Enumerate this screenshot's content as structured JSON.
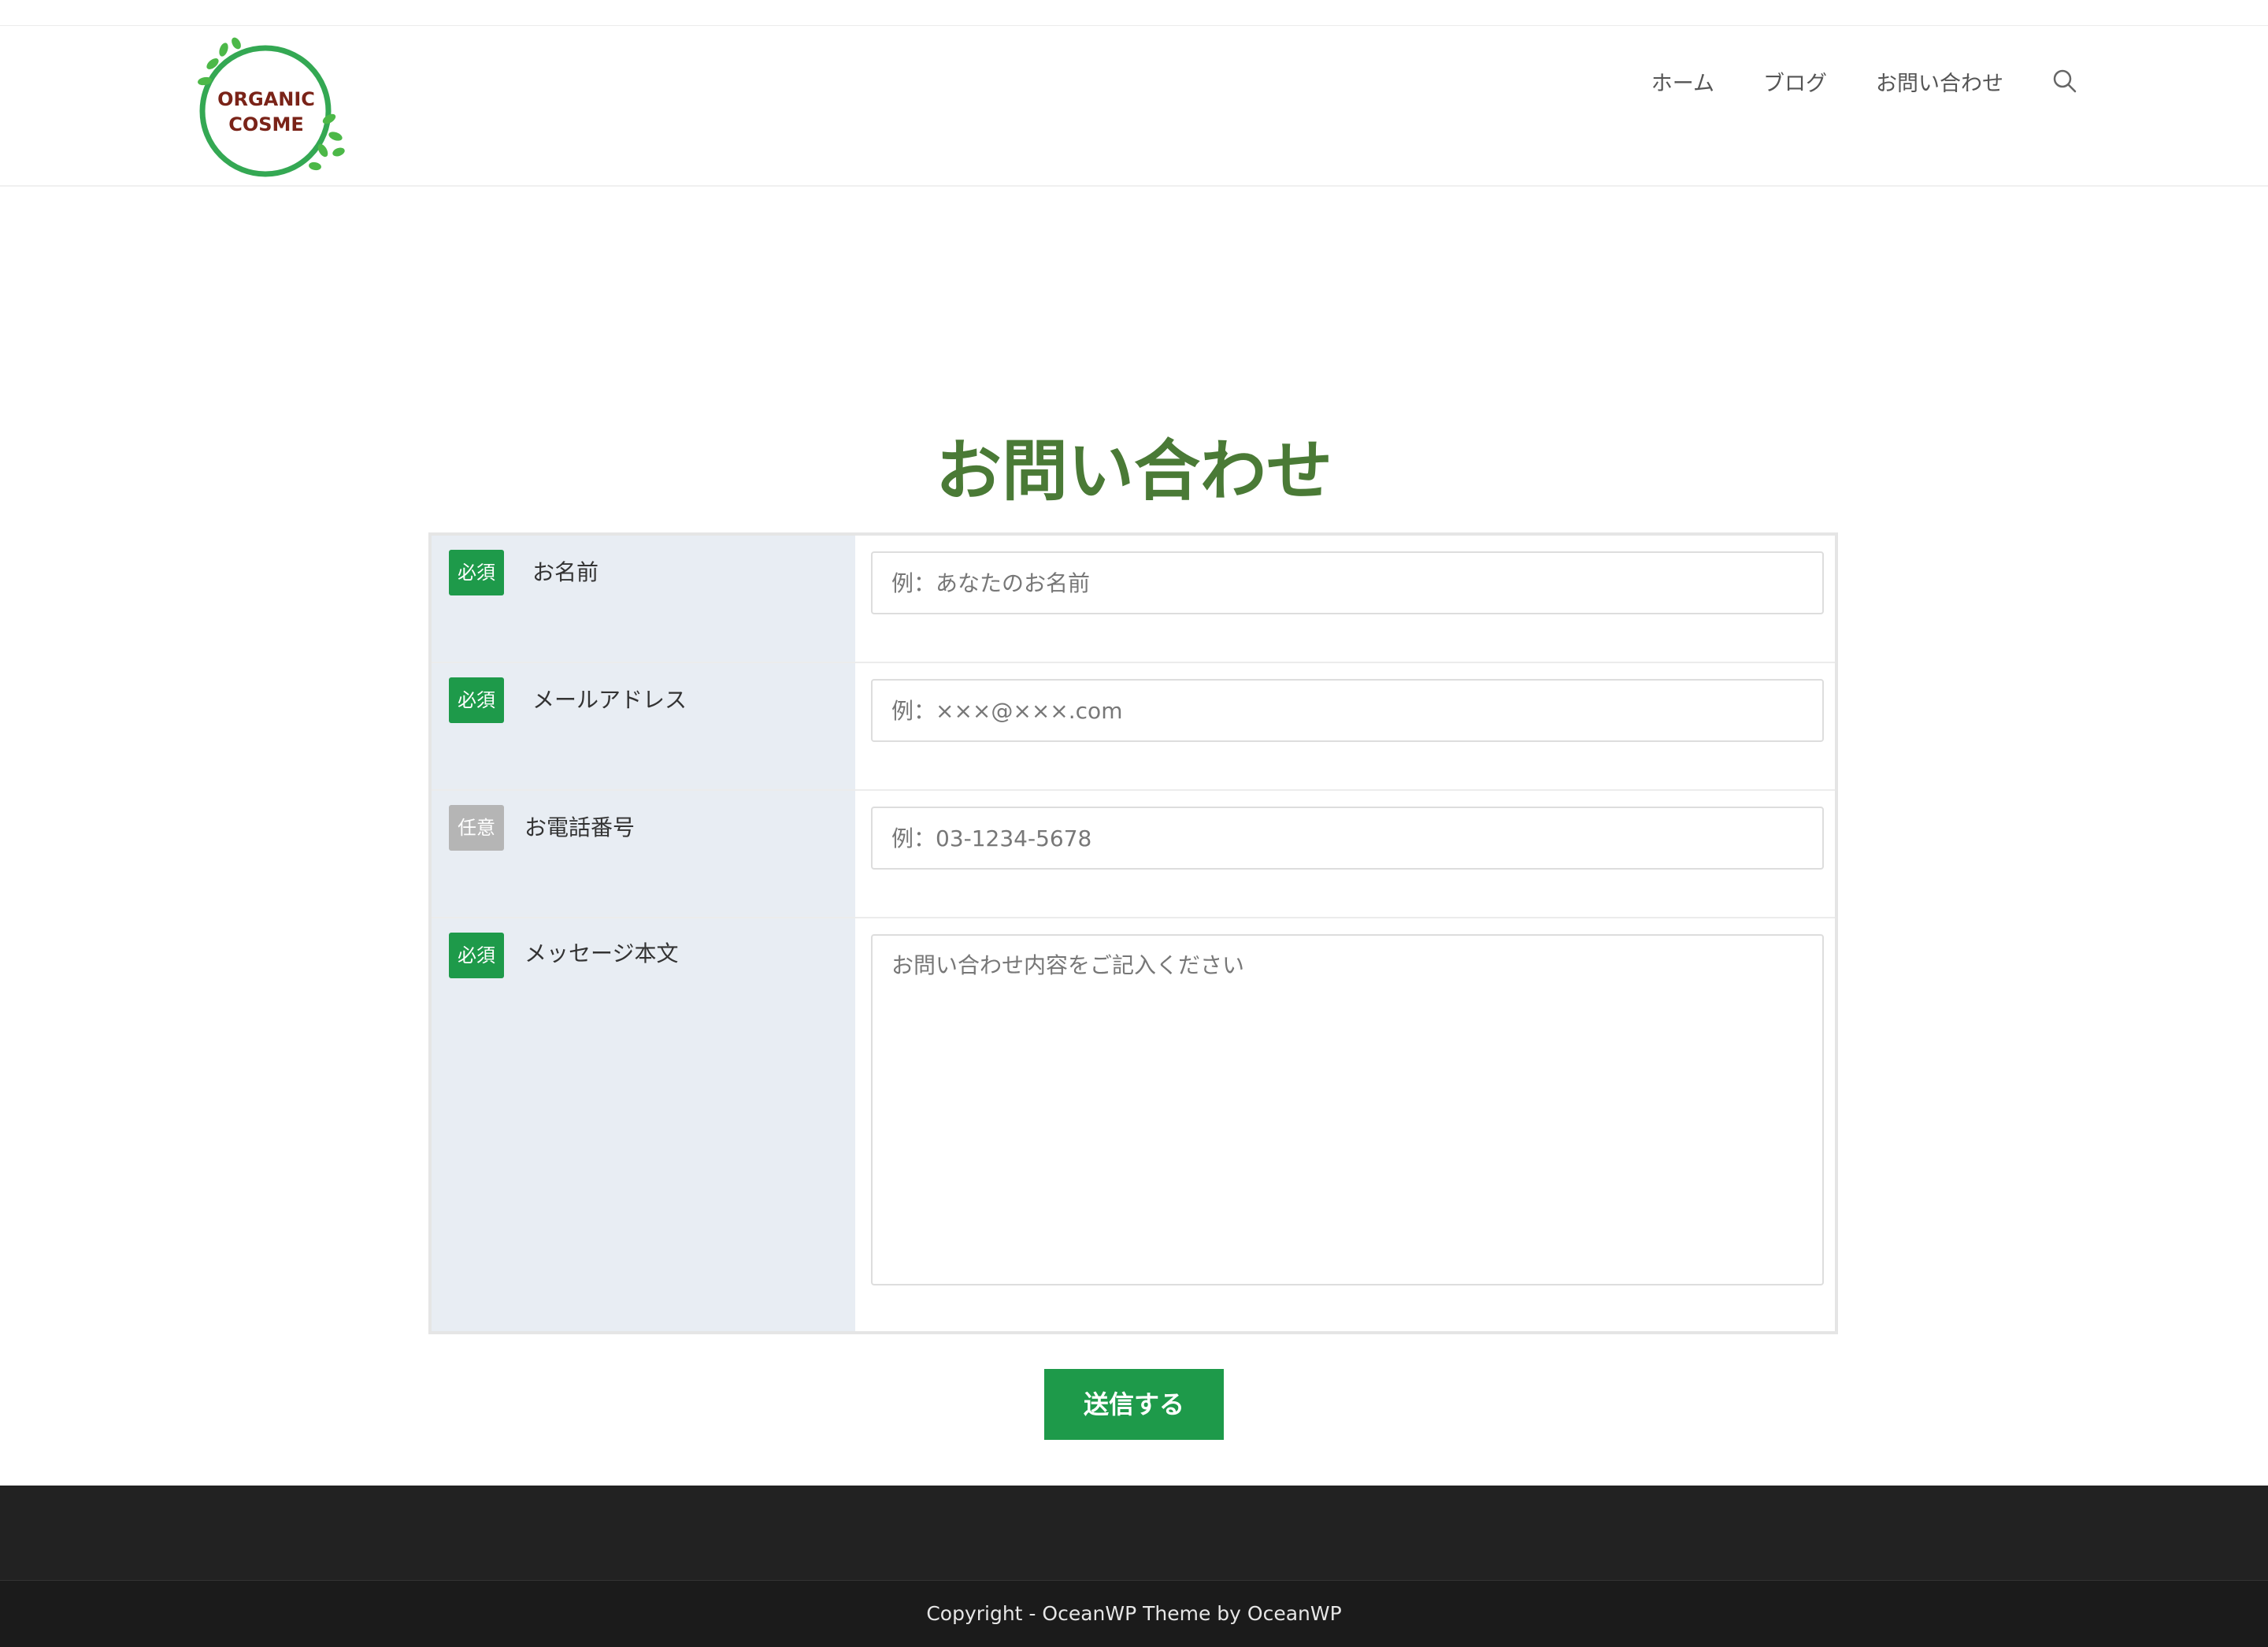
{
  "header": {
    "logo": {
      "text_line1": "ORGANIC",
      "text_line2": "COSME"
    },
    "nav": [
      {
        "label": "ホーム"
      },
      {
        "label": "ブログ"
      },
      {
        "label": "お問い合わせ"
      }
    ],
    "search_icon": "search-icon"
  },
  "page": {
    "title": "お問い合わせ"
  },
  "form": {
    "fields": [
      {
        "badge": "必須",
        "badge_type": "required",
        "label": "お名前",
        "placeholder": "例：あなたのお名前",
        "value": ""
      },
      {
        "badge": "必須",
        "badge_type": "required",
        "label": "メールアドレス",
        "placeholder": "例：×××@×××.com",
        "value": ""
      },
      {
        "badge": "任意",
        "badge_type": "optional",
        "label": "お電話番号",
        "placeholder": "例：03-1234-5678",
        "value": ""
      },
      {
        "badge": "必須",
        "badge_type": "required",
        "label": "メッセージ本文",
        "placeholder": "お問い合わせ内容をご記入ください",
        "value": ""
      }
    ],
    "submit_label": "送信する"
  },
  "footer": {
    "copyright": "Copyright - OceanWP Theme by OceanWP"
  },
  "colors": {
    "accent_green": "#1e9a4a",
    "title_green": "#4a7a36",
    "optional_gray": "#b5b5b5",
    "label_bg": "#e8edf3",
    "footer_bg": "#222222"
  }
}
